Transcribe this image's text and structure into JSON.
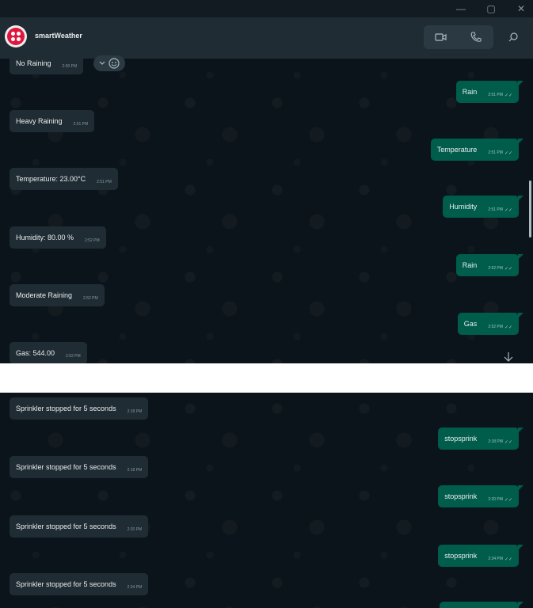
{
  "window": {
    "minimize": "—",
    "maximize": "▢",
    "close": "✕"
  },
  "header": {
    "contact_name": "smartWeather"
  },
  "icons": {
    "video": "video-camera-icon",
    "call": "phone-icon",
    "search": "search-icon",
    "emoji": "emoji-icon",
    "chevron": "chevron-down-icon",
    "scroll": "arrow-down-icon",
    "ticks": "✓✓"
  },
  "colors": {
    "background": "#0b141a",
    "header": "#202c33",
    "incoming_bubble": "#202c33",
    "outgoing_bubble": "#005c4b",
    "brand": "#e0173c"
  },
  "conversation_top": [
    {
      "text": "No Raining",
      "time": "2:50 PM",
      "direction": "in"
    },
    {
      "text": "Rain",
      "time": "2:51 PM",
      "direction": "out"
    },
    {
      "text": "Heavy Raining",
      "time": "2:51 PM",
      "direction": "in"
    },
    {
      "text": "Temperature",
      "time": "2:51 PM",
      "direction": "out"
    },
    {
      "text": "Temperature: 23.00°C",
      "time": "2:51 PM",
      "direction": "in"
    },
    {
      "text": "Humidity",
      "time": "2:51 PM",
      "direction": "out"
    },
    {
      "text": "Humidity: 80.00 %",
      "time": "2:52 PM",
      "direction": "in"
    },
    {
      "text": "Rain",
      "time": "2:52 PM",
      "direction": "out"
    },
    {
      "text": "Moderate Raining",
      "time": "2:52 PM",
      "direction": "in"
    },
    {
      "text": "Gas",
      "time": "2:52 PM",
      "direction": "out"
    },
    {
      "text": "Gas: 544.00",
      "time": "2:52 PM",
      "direction": "in"
    }
  ],
  "conversation_bottom": [
    {
      "text": "Sprinkler stopped for 5 seconds",
      "time": "2:18 PM",
      "direction": "in"
    },
    {
      "text": "stopsprink",
      "time": "2:18 PM",
      "direction": "out"
    },
    {
      "text": "Sprinkler stopped for 5 seconds",
      "time": "2:18 PM",
      "direction": "in"
    },
    {
      "text": "stopsprink",
      "time": "2:20 PM",
      "direction": "out"
    },
    {
      "text": "Sprinkler stopped for 5 seconds",
      "time": "2:20 PM",
      "direction": "in"
    },
    {
      "text": "stopsprink",
      "time": "2:34 PM",
      "direction": "out"
    },
    {
      "text": "Sprinkler stopped for 5 seconds",
      "time": "2:34 PM",
      "direction": "in"
    }
  ]
}
